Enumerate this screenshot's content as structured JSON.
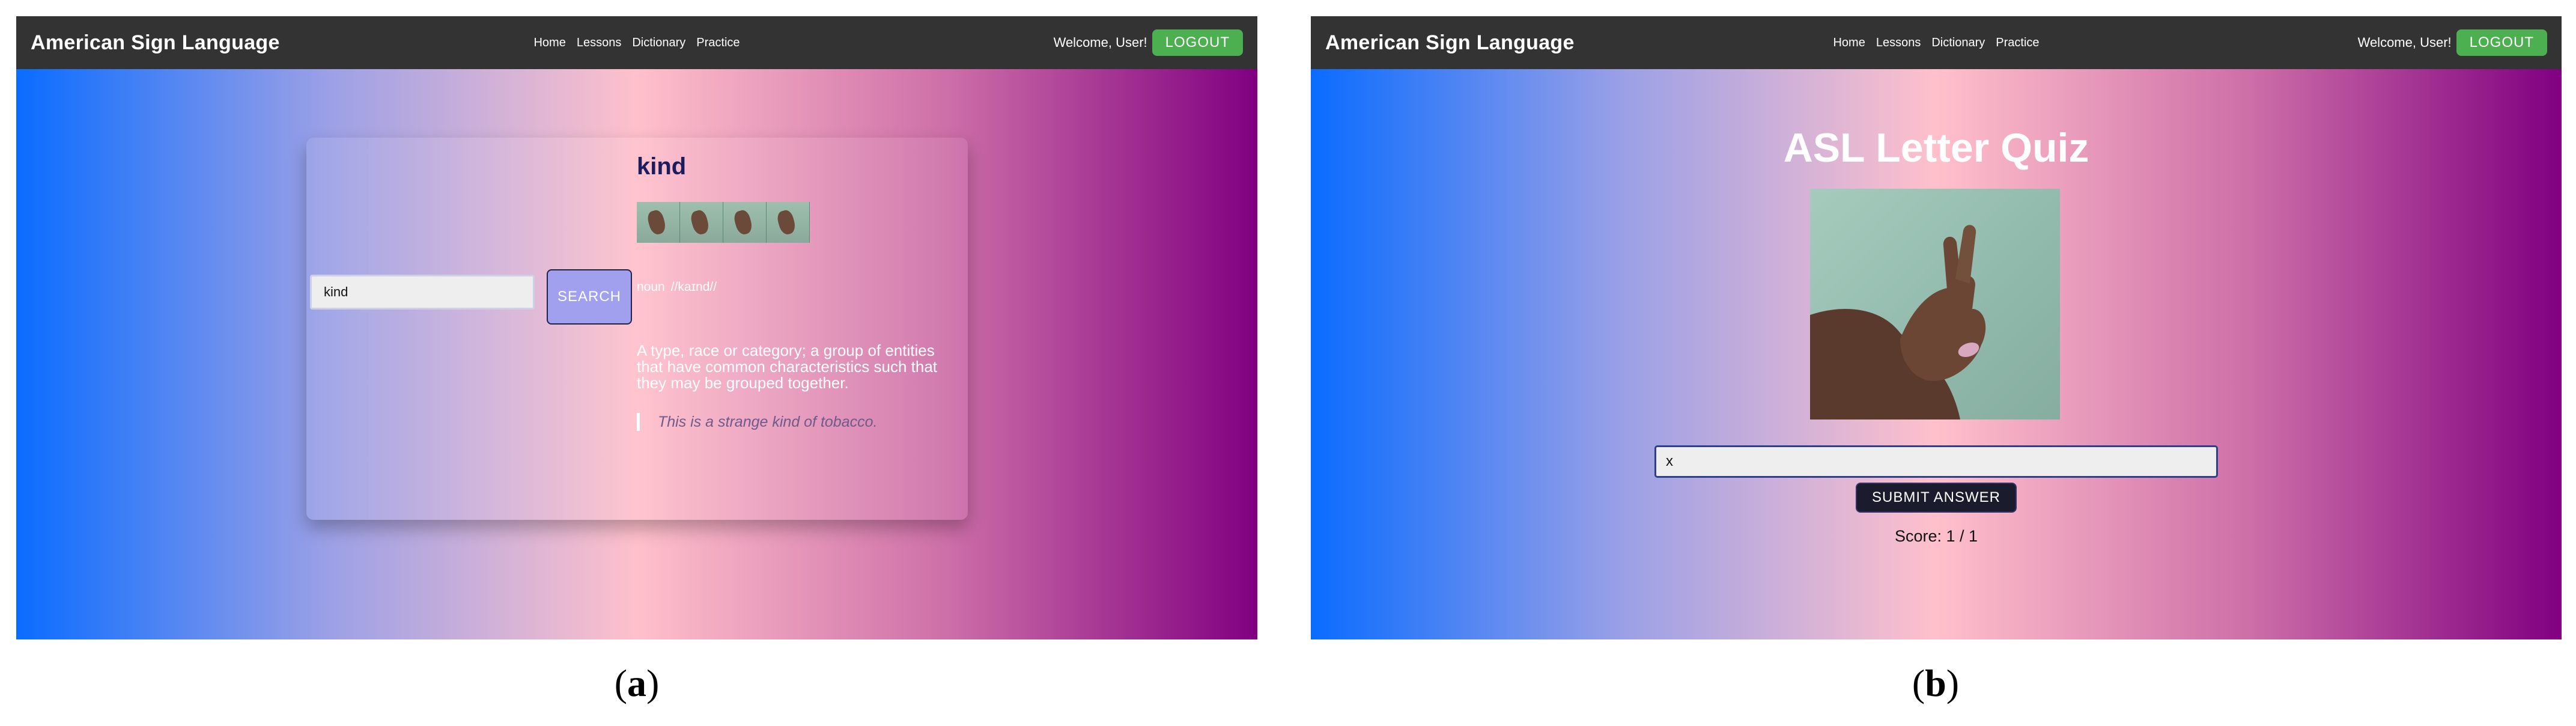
{
  "panel_a": {
    "navbar": {
      "brand": "American Sign Language",
      "links": [
        "Home",
        "Lessons",
        "Dictionary",
        "Practice"
      ],
      "welcome": "Welcome, User!",
      "logout_label": "LOGOUT"
    },
    "search": {
      "input_value": "kind",
      "button_label": "SEARCH"
    },
    "entry": {
      "word": "kind",
      "part_of_speech": "noun",
      "phonetic": "//kaɪnd//",
      "definition": "A type, race or category; a group of entities that have common characteristics such that they may be grouped together.",
      "example": "This is a strange kind of tobacco."
    },
    "caption_letter": "a"
  },
  "panel_b": {
    "navbar": {
      "brand": "American Sign Language",
      "links": [
        "Home",
        "Lessons",
        "Dictionary",
        "Practice"
      ],
      "welcome": "Welcome, User!",
      "logout_label": "LOGOUT"
    },
    "quiz": {
      "title": "ASL Letter Quiz",
      "answer_value": "x",
      "submit_label": "SUBMIT ANSWER",
      "score": "Score: 1 / 1"
    },
    "caption_letter": "b"
  },
  "colors": {
    "navbar": "#333333",
    "logout": "#4caf50",
    "gradient_start": "#0a6cff",
    "gradient_mid": "#ffc0cb",
    "gradient_end": "#800080",
    "search_button": "#a1a0ef",
    "word_title": "#1c1d5c"
  }
}
